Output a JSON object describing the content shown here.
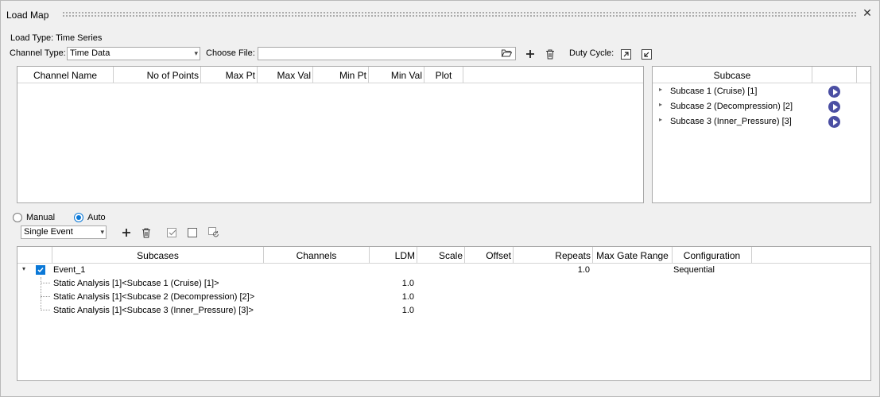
{
  "window": {
    "title": "Load Map"
  },
  "top": {
    "load_type_label": "Load Type: Time Series",
    "channel_type_label": "Channel Type:",
    "channel_type_value": "Time Data",
    "choose_file_label": "Choose File:",
    "choose_file_value": "",
    "duty_cycle_label": "Duty Cycle:"
  },
  "channels_table": {
    "columns": [
      "Channel Name",
      "No of Points",
      "Max Pt",
      "Max Val",
      "Min Pt",
      "Min Val",
      "Plot"
    ]
  },
  "subcase_panel": {
    "header": "Subcase",
    "items": [
      "Subcase 1 (Cruise) [1]",
      "Subcase 2 (Decompression) [2]",
      "Subcase 3 (Inner_Pressure) [3]"
    ]
  },
  "mode": {
    "manual_label": "Manual",
    "auto_label": "Auto",
    "selected": "Auto"
  },
  "event_type": {
    "value": "Single Event"
  },
  "events_table": {
    "columns": [
      "Subcases",
      "Channels",
      "LDM",
      "Scale",
      "Offset",
      "Repeats",
      "Max Gate Range",
      "Configuration"
    ],
    "event": {
      "name": "Event_1",
      "repeats": "1.0",
      "configuration": "Sequential"
    },
    "rows": [
      {
        "subcase": "Static Analysis [1]<Subcase 1 (Cruise) [1]>",
        "ldm": "1.0"
      },
      {
        "subcase": "Static Analysis [1]<Subcase 2 (Decompression) [2]>",
        "ldm": "1.0"
      },
      {
        "subcase": "Static Analysis [1]<Subcase 3 (Inner_Pressure) [3]>",
        "ldm": "1.0"
      }
    ]
  },
  "icons": {
    "close": "close-icon",
    "folder": "folder-open-icon",
    "add": "plus-icon",
    "delete": "trash-icon",
    "duty_export": "export-arrow-icon",
    "duty_import": "import-arrow-icon",
    "play": "play-icon",
    "check_all": "check-all-icon",
    "uncheck_all": "uncheck-all-icon",
    "refresh": "refresh-icon"
  },
  "colors": {
    "accent": "#0a78d7",
    "play": "#4b4fa3"
  }
}
